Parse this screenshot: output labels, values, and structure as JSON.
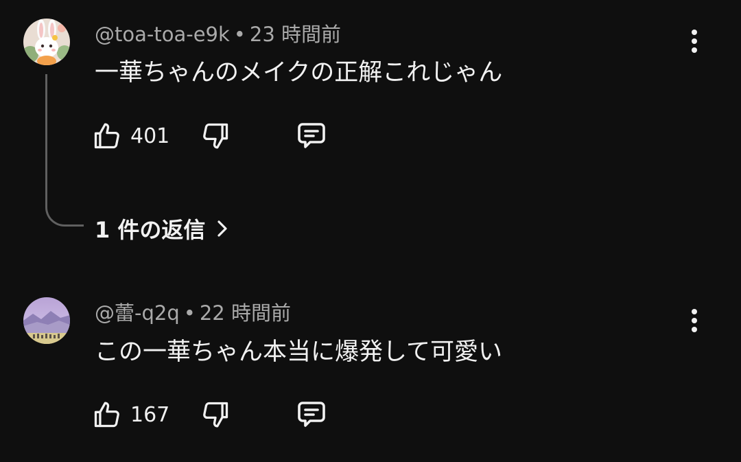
{
  "comments": [
    {
      "handle": "@toa-toa-e9k",
      "time": "23 時間前",
      "text": "一華ちゃんのメイクの正解これじゃん",
      "likes": "401",
      "avatar_icon": "bunny-avatar"
    },
    {
      "handle": "@蕾-q2q",
      "time": "22 時間前",
      "text": "この一華ちゃん本当に爆発して可愛い",
      "likes": "167",
      "avatar_icon": "landscape-avatar"
    }
  ],
  "replies_link": {
    "label": "1 件の返信"
  },
  "separator": "•",
  "colors": {
    "background": "#0f0f0f",
    "text_primary": "#f1f1f1",
    "text_secondary": "#aaaaaa",
    "thread_line": "#606060"
  }
}
